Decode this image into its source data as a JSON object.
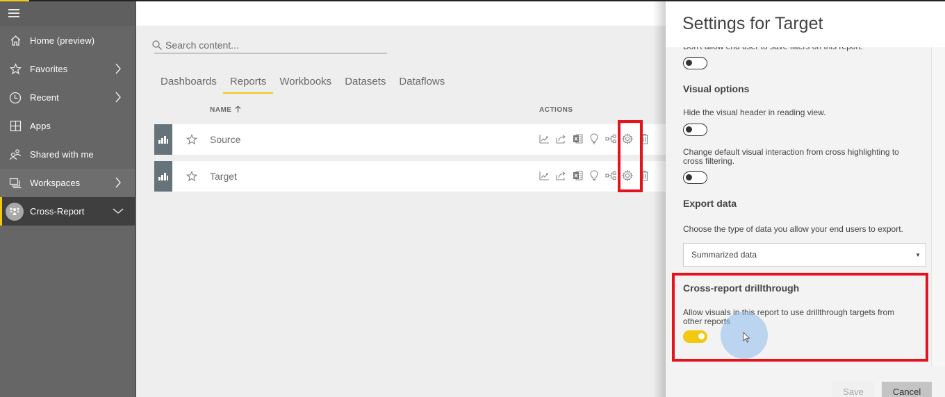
{
  "sidebar": {
    "items": [
      {
        "label": "Home (preview)",
        "icon": "home-icon"
      },
      {
        "label": "Favorites",
        "icon": "star-icon",
        "has_chevron": true
      },
      {
        "label": "Recent",
        "icon": "clock-icon",
        "has_chevron": true
      },
      {
        "label": "Apps",
        "icon": "apps-icon"
      },
      {
        "label": "Shared with me",
        "icon": "people-icon"
      },
      {
        "label": "Workspaces",
        "icon": "workspaces-icon",
        "has_chevron": true
      },
      {
        "label": "Cross-Report",
        "icon": "workspace-avatar-icon",
        "expanded": true,
        "active": true
      }
    ]
  },
  "main": {
    "search": {
      "placeholder": "Search content..."
    },
    "tabs": [
      {
        "label": "Dashboards"
      },
      {
        "label": "Reports",
        "active": true
      },
      {
        "label": "Workbooks"
      },
      {
        "label": "Datasets"
      },
      {
        "label": "Dataflows"
      }
    ],
    "columns": {
      "name": "NAME",
      "actions": "ACTIONS"
    },
    "rows": [
      {
        "name": "Source"
      },
      {
        "name": "Target"
      }
    ],
    "action_icons": [
      "analytics-icon",
      "share-icon",
      "excel-icon",
      "insights-icon",
      "lineage-icon",
      "settings-icon",
      "delete-icon"
    ]
  },
  "panel": {
    "title": "Settings for Target",
    "filters_text": "Don't allow end user to save filters on this report.",
    "filters_toggle": false,
    "visual_options": {
      "heading": "Visual options",
      "hide_header_text": "Hide the visual header in reading view.",
      "hide_header_toggle": false,
      "cross_filter_text_1": "Change default visual interaction from cross highlighting to",
      "cross_filter_text_2": "cross filtering.",
      "cross_filter_toggle": false
    },
    "export_data": {
      "heading": "Export data",
      "description": "Choose the type of data you allow your end users to export.",
      "selected": "Summarized data"
    },
    "cross_report": {
      "heading": "Cross-report drillthrough",
      "description_1": "Allow visuals in this report to use drillthrough targets from",
      "description_2": "other reports",
      "toggle": true
    },
    "buttons": {
      "save": "Save",
      "cancel": "Cancel"
    }
  },
  "colors": {
    "accent": "#f2c811",
    "highlight": "#e3141e",
    "sidebar": "#666666"
  }
}
